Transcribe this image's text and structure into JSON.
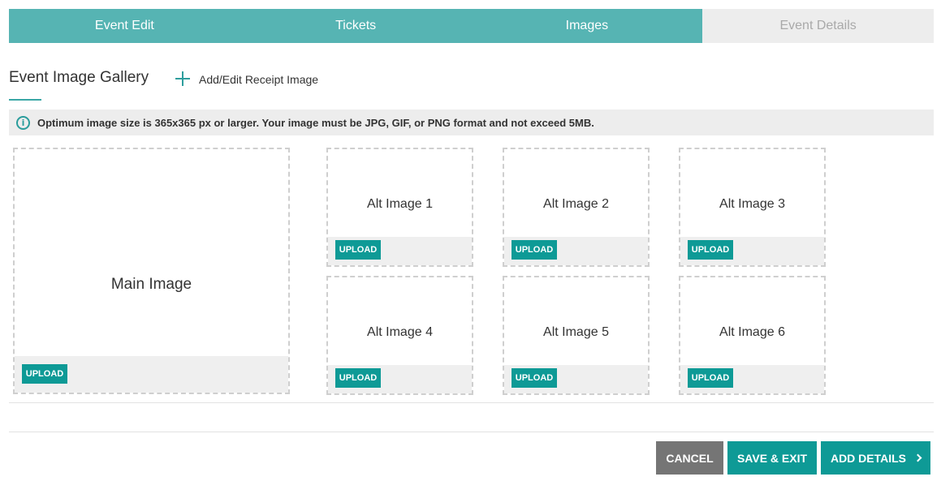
{
  "tabs": [
    {
      "label": "Event Edit",
      "state": "active"
    },
    {
      "label": "Tickets",
      "state": "active"
    },
    {
      "label": "Images",
      "state": "active"
    },
    {
      "label": "Event Details",
      "state": "inactive"
    }
  ],
  "gallery": {
    "title": "Event Image Gallery",
    "add_receipt_label": "Add/Edit Receipt Image",
    "add_receipt_icon": "plus-icon"
  },
  "info": {
    "icon": "info-icon",
    "icon_glyph": "i",
    "text": "Optimum image size is 365x365 px or larger. Your image must be JPG, GIF, or PNG format and not exceed 5MB."
  },
  "images": {
    "main": {
      "label": "Main Image",
      "upload_label": "UPLOAD"
    },
    "alts": [
      {
        "label": "Alt Image 1",
        "upload_label": "UPLOAD"
      },
      {
        "label": "Alt Image 2",
        "upload_label": "UPLOAD"
      },
      {
        "label": "Alt Image 3",
        "upload_label": "UPLOAD"
      },
      {
        "label": "Alt Image 4",
        "upload_label": "UPLOAD"
      },
      {
        "label": "Alt Image 5",
        "upload_label": "UPLOAD"
      },
      {
        "label": "Alt Image 6",
        "upload_label": "UPLOAD"
      }
    ]
  },
  "footer": {
    "cancel_label": "CANCEL",
    "save_exit_label": "SAVE & EXIT",
    "add_details_label": "ADD DETAILS",
    "add_details_icon": "chevron-right-icon"
  },
  "colors": {
    "accent": "#0e9a96",
    "tab_active": "#56b4b3",
    "tab_inactive": "#ededed",
    "cancel": "#757575"
  }
}
